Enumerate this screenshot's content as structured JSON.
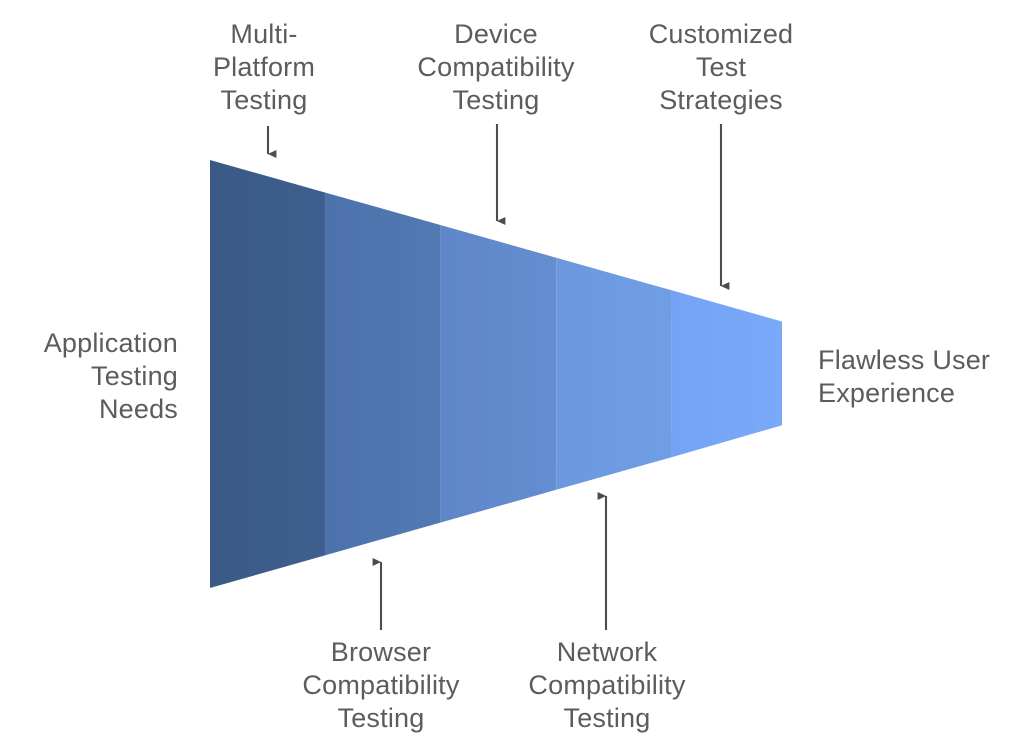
{
  "diagram": {
    "type": "funnel",
    "title": "",
    "background_color": "#ffffff",
    "text_color": "#5c5c5c",
    "arrow_color": "#4d4d4d",
    "input_label": "Application\nTesting\nNeeds",
    "output_label": "Flawless User\nExperience",
    "stages": [
      {
        "index": 1,
        "label": "Multi-\nPlatform\nTesting",
        "color": "#3b5a88",
        "callout_side": "top"
      },
      {
        "index": 2,
        "label": "Browser\nCompatibility\nTesting",
        "color": "#4f74ad",
        "callout_side": "bottom"
      },
      {
        "index": 3,
        "label": "Device\nCompatibility\nTesting",
        "color": "#6089cb",
        "callout_side": "top"
      },
      {
        "index": 4,
        "label": "Network\nCompatibility\nTesting",
        "color": "#6d9ae0",
        "callout_side": "bottom"
      },
      {
        "index": 5,
        "label": "Customized\nTest\nStrategies",
        "color": "#76a5f7",
        "callout_side": "top"
      }
    ]
  },
  "chart_data": {
    "type": "funnel",
    "title": "",
    "xlabel": "",
    "ylabel": "",
    "categories": [
      "Multi-Platform Testing",
      "Browser Compatibility Testing",
      "Device Compatibility Testing",
      "Network Compatibility Testing",
      "Customized Test Strategies"
    ],
    "values": [
      428,
      364,
      300,
      236,
      172
    ],
    "colors": [
      "#3b5a88",
      "#4f74ad",
      "#6089cb",
      "#6d9ae0",
      "#76a5f7"
    ],
    "entry_label": "Application Testing Needs",
    "exit_label": "Flawless User Experience",
    "grid": false,
    "legend": "none",
    "annotations": [
      "Multi-Platform Testing",
      "Device Compatibility Testing",
      "Customized Test Strategies",
      "Browser Compatibility Testing",
      "Network Compatibility Testing"
    ]
  }
}
